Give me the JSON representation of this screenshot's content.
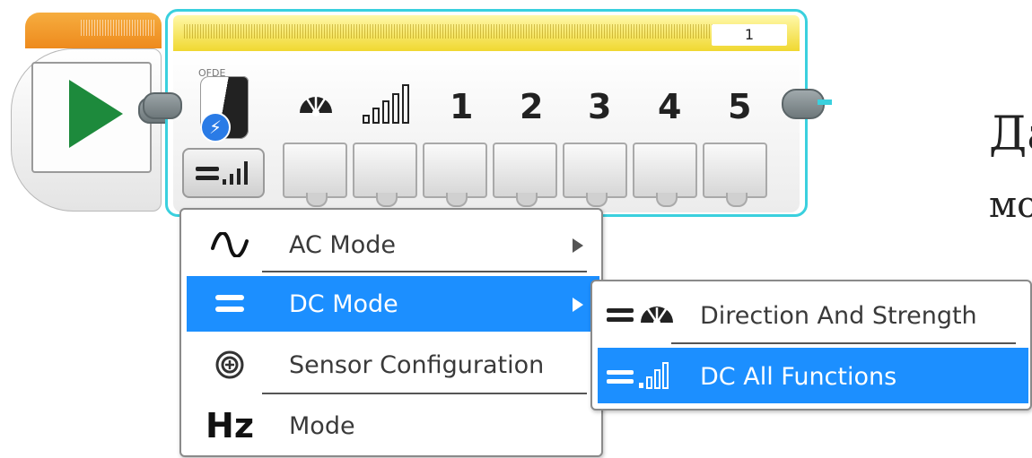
{
  "sensor_block": {
    "port_number": "1",
    "sensor_label": "OFDE",
    "header_icons": [
      "direction-strength-icon",
      "signal-strength-icon"
    ],
    "channels": [
      "1",
      "2",
      "3",
      "4",
      "5"
    ],
    "bolt_glyph": "⚡"
  },
  "mode_menu": {
    "items": [
      {
        "label": "AC Mode",
        "icon": "sine-wave-icon",
        "has_submenu": true,
        "selected": false
      },
      {
        "label": "DC Mode",
        "icon": "dc-lines-icon",
        "has_submenu": true,
        "selected": true
      },
      {
        "label": "Sensor Configuration",
        "icon": "target-icon",
        "has_submenu": false,
        "selected": false
      },
      {
        "label": "Mode",
        "icon": "hz-icon",
        "icon_text": "Hz",
        "has_submenu": false,
        "selected": false
      }
    ]
  },
  "dc_submenu": {
    "items": [
      {
        "label": "Direction And Strength",
        "icon": "direction-strength-icon",
        "selected": false
      },
      {
        "label": "DC All Functions",
        "icon": "signal-strength-icon",
        "selected": true
      }
    ]
  },
  "side_text": {
    "line1": "Да",
    "line2": "мо"
  },
  "colors": {
    "selection": "#1c8fff",
    "block_outline": "#3ad0de",
    "start_header": "#f0961f",
    "sensor_header": "#f4dd3a",
    "play": "#1d8a3c"
  }
}
